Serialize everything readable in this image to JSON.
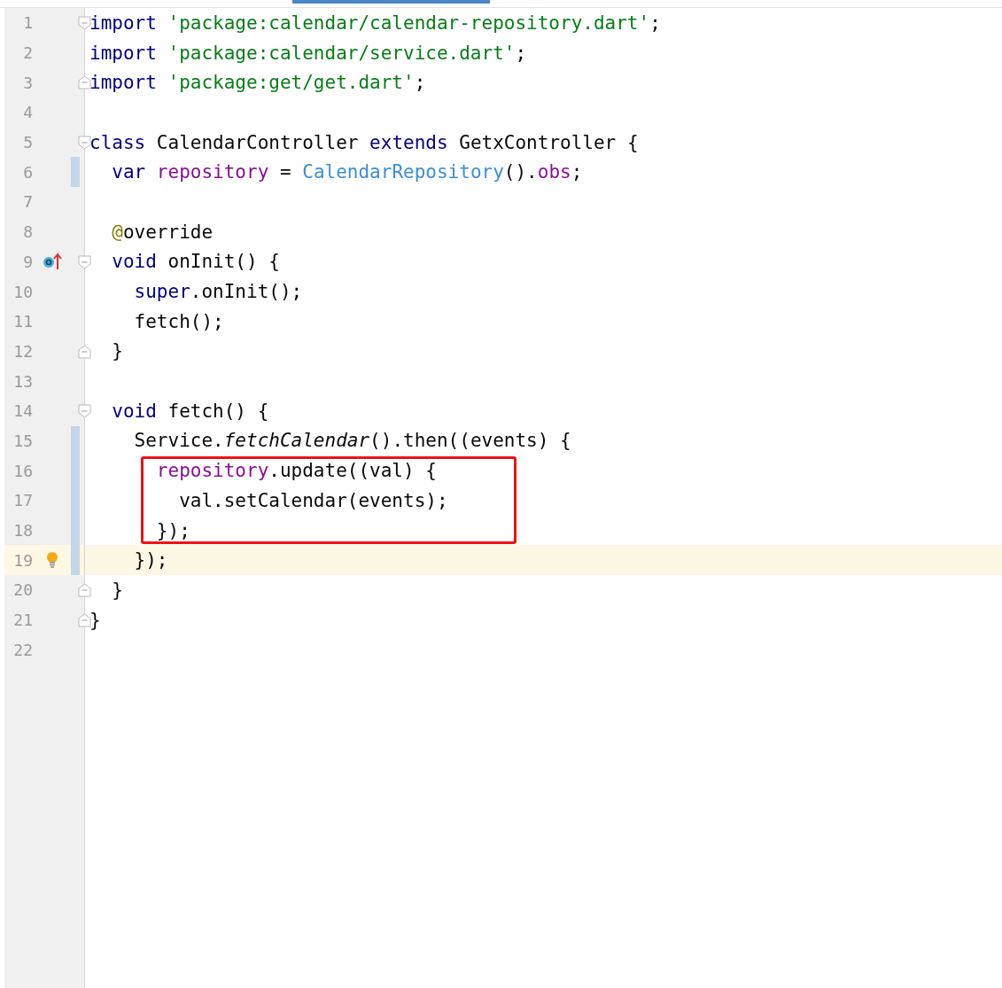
{
  "editor": {
    "blocks": [
      {
        "kind": "line",
        "line": {
          "number": "1",
          "fold_start": true,
          "tokens": [
            {
              "kind": "keyword",
              "text": "import"
            },
            {
              "kind": "string",
              "text": " 'package:calendar/calendar-repository.dart'"
            },
            {
              "kind": "plain",
              "text": ";"
            }
          ]
        }
      },
      {
        "kind": "line",
        "line": {
          "number": "2",
          "tokens": [
            {
              "kind": "keyword",
              "text": "import"
            },
            {
              "kind": "string",
              "text": " 'package:calendar/service.dart'"
            },
            {
              "kind": "plain",
              "text": ";"
            }
          ]
        }
      },
      {
        "kind": "line",
        "line": {
          "number": "3",
          "fold_end": true,
          "tokens": [
            {
              "kind": "keyword",
              "text": "import"
            },
            {
              "kind": "string",
              "text": " 'package:get/get.dart'"
            },
            {
              "kind": "plain",
              "text": ";"
            }
          ]
        }
      },
      {
        "kind": "line",
        "line": {
          "number": "4"
        }
      },
      {
        "kind": "line",
        "line": {
          "number": "5",
          "fold_start": true,
          "tokens": [
            {
              "kind": "keyword",
              "text": "class"
            },
            {
              "kind": "plain",
              "text": " CalendarController "
            },
            {
              "kind": "keyword",
              "text": "extends"
            },
            {
              "kind": "plain",
              "text": " GetxController {"
            }
          ]
        }
      },
      {
        "kind": "line",
        "line": {
          "number": "6",
          "changed": true,
          "tokens": [
            {
              "kind": "keyword",
              "text": "  var"
            },
            {
              "kind": "field",
              "text": " repository"
            },
            {
              "kind": "plain",
              "text": " = "
            },
            {
              "kind": "type",
              "text": "CalendarRepository"
            },
            {
              "kind": "plain",
              "text": "()."
            },
            {
              "kind": "field",
              "text": "obs"
            },
            {
              "kind": "plain",
              "text": ";"
            }
          ]
        }
      },
      {
        "kind": "line",
        "line": {
          "number": "7"
        }
      },
      {
        "kind": "line",
        "line": {
          "number": "8",
          "tokens": [
            {
              "kind": "annotation",
              "text": "  @"
            },
            {
              "kind": "plain",
              "text": "override"
            }
          ]
        }
      },
      {
        "kind": "line",
        "line": {
          "number": "9",
          "fold_start": true,
          "override_marker": true,
          "tokens": [
            {
              "kind": "keyword",
              "text": "  void"
            },
            {
              "kind": "plain",
              "text": " onInit() {"
            }
          ]
        }
      },
      {
        "kind": "line",
        "line": {
          "number": "10",
          "tokens": [
            {
              "kind": "keyword",
              "text": "    super"
            },
            {
              "kind": "plain",
              "text": ".onInit();"
            }
          ]
        }
      },
      {
        "kind": "line",
        "line": {
          "number": "11",
          "tokens": [
            {
              "kind": "plain",
              "text": "    fetch();"
            }
          ]
        }
      },
      {
        "kind": "line",
        "line": {
          "number": "12",
          "fold_end": true,
          "tokens": [
            {
              "kind": "plain",
              "text": "  }"
            }
          ]
        }
      },
      {
        "kind": "line",
        "line": {
          "number": "13"
        }
      },
      {
        "kind": "line",
        "line": {
          "number": "14",
          "fold_start": true,
          "tokens": [
            {
              "kind": "keyword",
              "text": "  void"
            },
            {
              "kind": "plain",
              "text": " fetch() {"
            }
          ]
        }
      },
      {
        "kind": "line",
        "line": {
          "number": "15",
          "changed": true,
          "tokens": [
            {
              "kind": "plain",
              "text": "    Service."
            },
            {
              "kind": "static",
              "text": "fetchCalendar"
            },
            {
              "kind": "plain",
              "text": "().then((events) {"
            }
          ]
        }
      },
      {
        "kind": "boxed",
        "lines": [
          {
            "number": "16",
            "changed": true,
            "tokens": [
              {
                "kind": "field",
                "text": "      repository"
              },
              {
                "kind": "plain",
                "text": ".update((val) {"
              }
            ]
          },
          {
            "number": "17",
            "changed": true,
            "tokens": [
              {
                "kind": "plain",
                "text": "        val.setCalendar(events);"
              }
            ]
          },
          {
            "number": "18",
            "changed": true,
            "tokens": [
              {
                "kind": "plain",
                "text": "      });"
              }
            ]
          }
        ]
      },
      {
        "kind": "line",
        "line": {
          "number": "19",
          "changed": true,
          "current": true,
          "hint_bulb": true,
          "tokens": [
            {
              "kind": "plain",
              "text": "    });"
            }
          ]
        }
      },
      {
        "kind": "line",
        "line": {
          "number": "20",
          "fold_end": true,
          "tokens": [
            {
              "kind": "plain",
              "text": "  }"
            }
          ]
        }
      },
      {
        "kind": "line",
        "line": {
          "number": "21",
          "fold_end": true,
          "tokens": [
            {
              "kind": "plain",
              "text": "}"
            }
          ]
        }
      },
      {
        "kind": "line",
        "line": {
          "number": "22"
        }
      }
    ]
  }
}
